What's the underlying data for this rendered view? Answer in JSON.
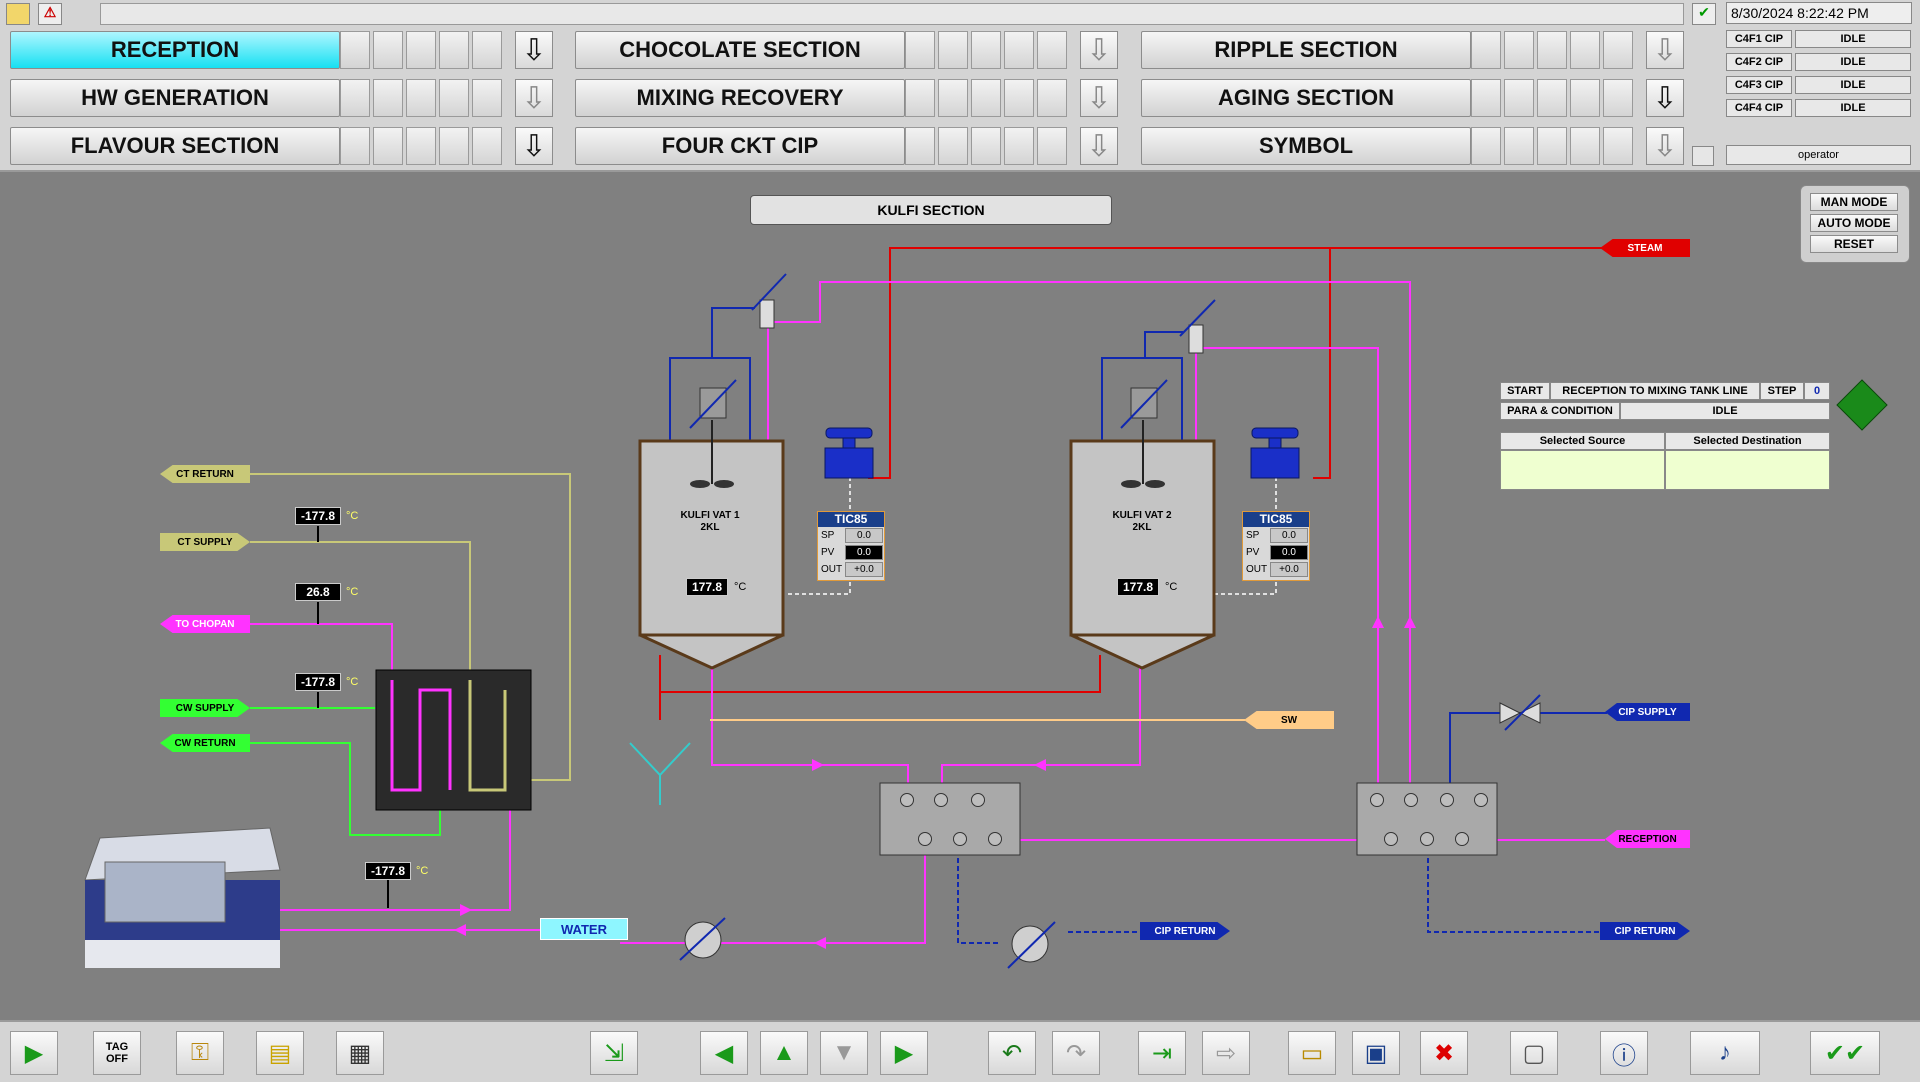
{
  "header": {
    "datetime": "8/30/2024 8:22:42 PM",
    "user": "operator",
    "cip_status": [
      {
        "name": "C4F1 CIP",
        "status": "IDLE"
      },
      {
        "name": "C4F2 CIP",
        "status": "IDLE"
      },
      {
        "name": "C4F3 CIP",
        "status": "IDLE"
      },
      {
        "name": "C4F4 CIP",
        "status": "IDLE"
      }
    ]
  },
  "nav": [
    {
      "label": "RECEPTION",
      "active": true
    },
    {
      "label": "HW GENERATION"
    },
    {
      "label": "FLAVOUR SECTION"
    },
    {
      "label": "CHOCOLATE SECTION"
    },
    {
      "label": "MIXING RECOVERY"
    },
    {
      "label": "FOUR CKT CIP"
    },
    {
      "label": "RIPPLE SECTION"
    },
    {
      "label": "AGING SECTION"
    },
    {
      "label": "SYMBOL"
    }
  ],
  "section_title": "KULFI SECTION",
  "modes": {
    "man": "MAN MODE",
    "auto": "AUTO MODE",
    "reset": "RESET"
  },
  "tags": {
    "steam": "STEAM",
    "ct_return": "CT RETURN",
    "ct_supply": "CT SUPPLY",
    "to_chopan": "TO CHOPAN",
    "cw_supply": "CW SUPPLY",
    "cw_return": "CW RETURN",
    "sw": "SW",
    "cip_supply": "CIP SUPPLY",
    "reception": "RECEPTION",
    "cip_return_1": "CIP RETURN",
    "cip_return_2": "CIP RETURN",
    "water": "WATER"
  },
  "temps": {
    "t1": "-177.8",
    "t2": "26.8",
    "t3": "-177.8",
    "t4": "-177.8",
    "vat1": "177.8",
    "vat2": "177.8",
    "unit": "°C"
  },
  "vats": [
    {
      "name": "KULFI VAT 1",
      "size": "2KL"
    },
    {
      "name": "KULFI VAT 2",
      "size": "2KL"
    }
  ],
  "tics": [
    {
      "tag": "TIC85",
      "sp_label": "SP",
      "pv_label": "PV",
      "out_label": "OUT",
      "sp": "0.0",
      "pv": "0.0",
      "out": "+0.0"
    },
    {
      "tag": "TIC85",
      "sp_label": "SP",
      "pv_label": "PV",
      "out_label": "OUT",
      "sp": "0.0",
      "pv": "0.0",
      "out": "+0.0"
    }
  ],
  "sequence": {
    "start_label": "START",
    "route": "RECEPTION TO MIXING TANK LINE",
    "step_label": "STEP",
    "step_value": "0",
    "para_label": "PARA & CONDITION",
    "status": "IDLE",
    "col_source": "Selected Source",
    "col_dest": "Selected Destination",
    "source_value": "",
    "dest_value": ""
  },
  "toolbar": {
    "tag_off": "TAG\nOFF"
  },
  "colors": {
    "steam": "#e00000",
    "magenta": "#ff33ff",
    "blue": "#1028b0",
    "cyan_active": "#17e0f2",
    "green_tag": "#33ff33",
    "ct": "#c8c878",
    "sw": "#ffcc88"
  }
}
